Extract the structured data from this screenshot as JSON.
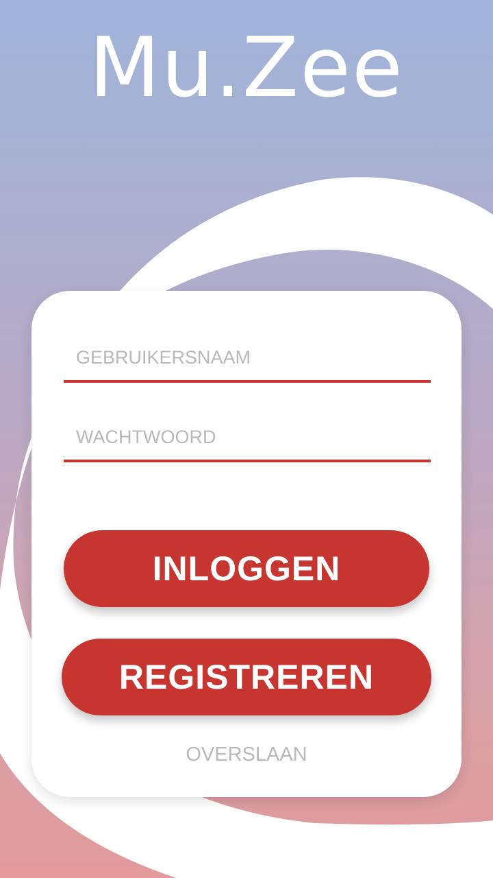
{
  "app": {
    "logo_text": "Mu.Zee"
  },
  "login_form": {
    "username_placeholder": "GEBRUIKERSNAAM",
    "password_placeholder": "WACHTWOORD",
    "login_label": "INLOGGEN",
    "register_label": "REGISTREREN",
    "skip_label": "OVERSLAAN"
  },
  "colors": {
    "accent": "#c6352f",
    "gradient_top": "#9fb4da",
    "gradient_bottom": "#e29a9a",
    "placeholder": "#b8b8b8"
  }
}
